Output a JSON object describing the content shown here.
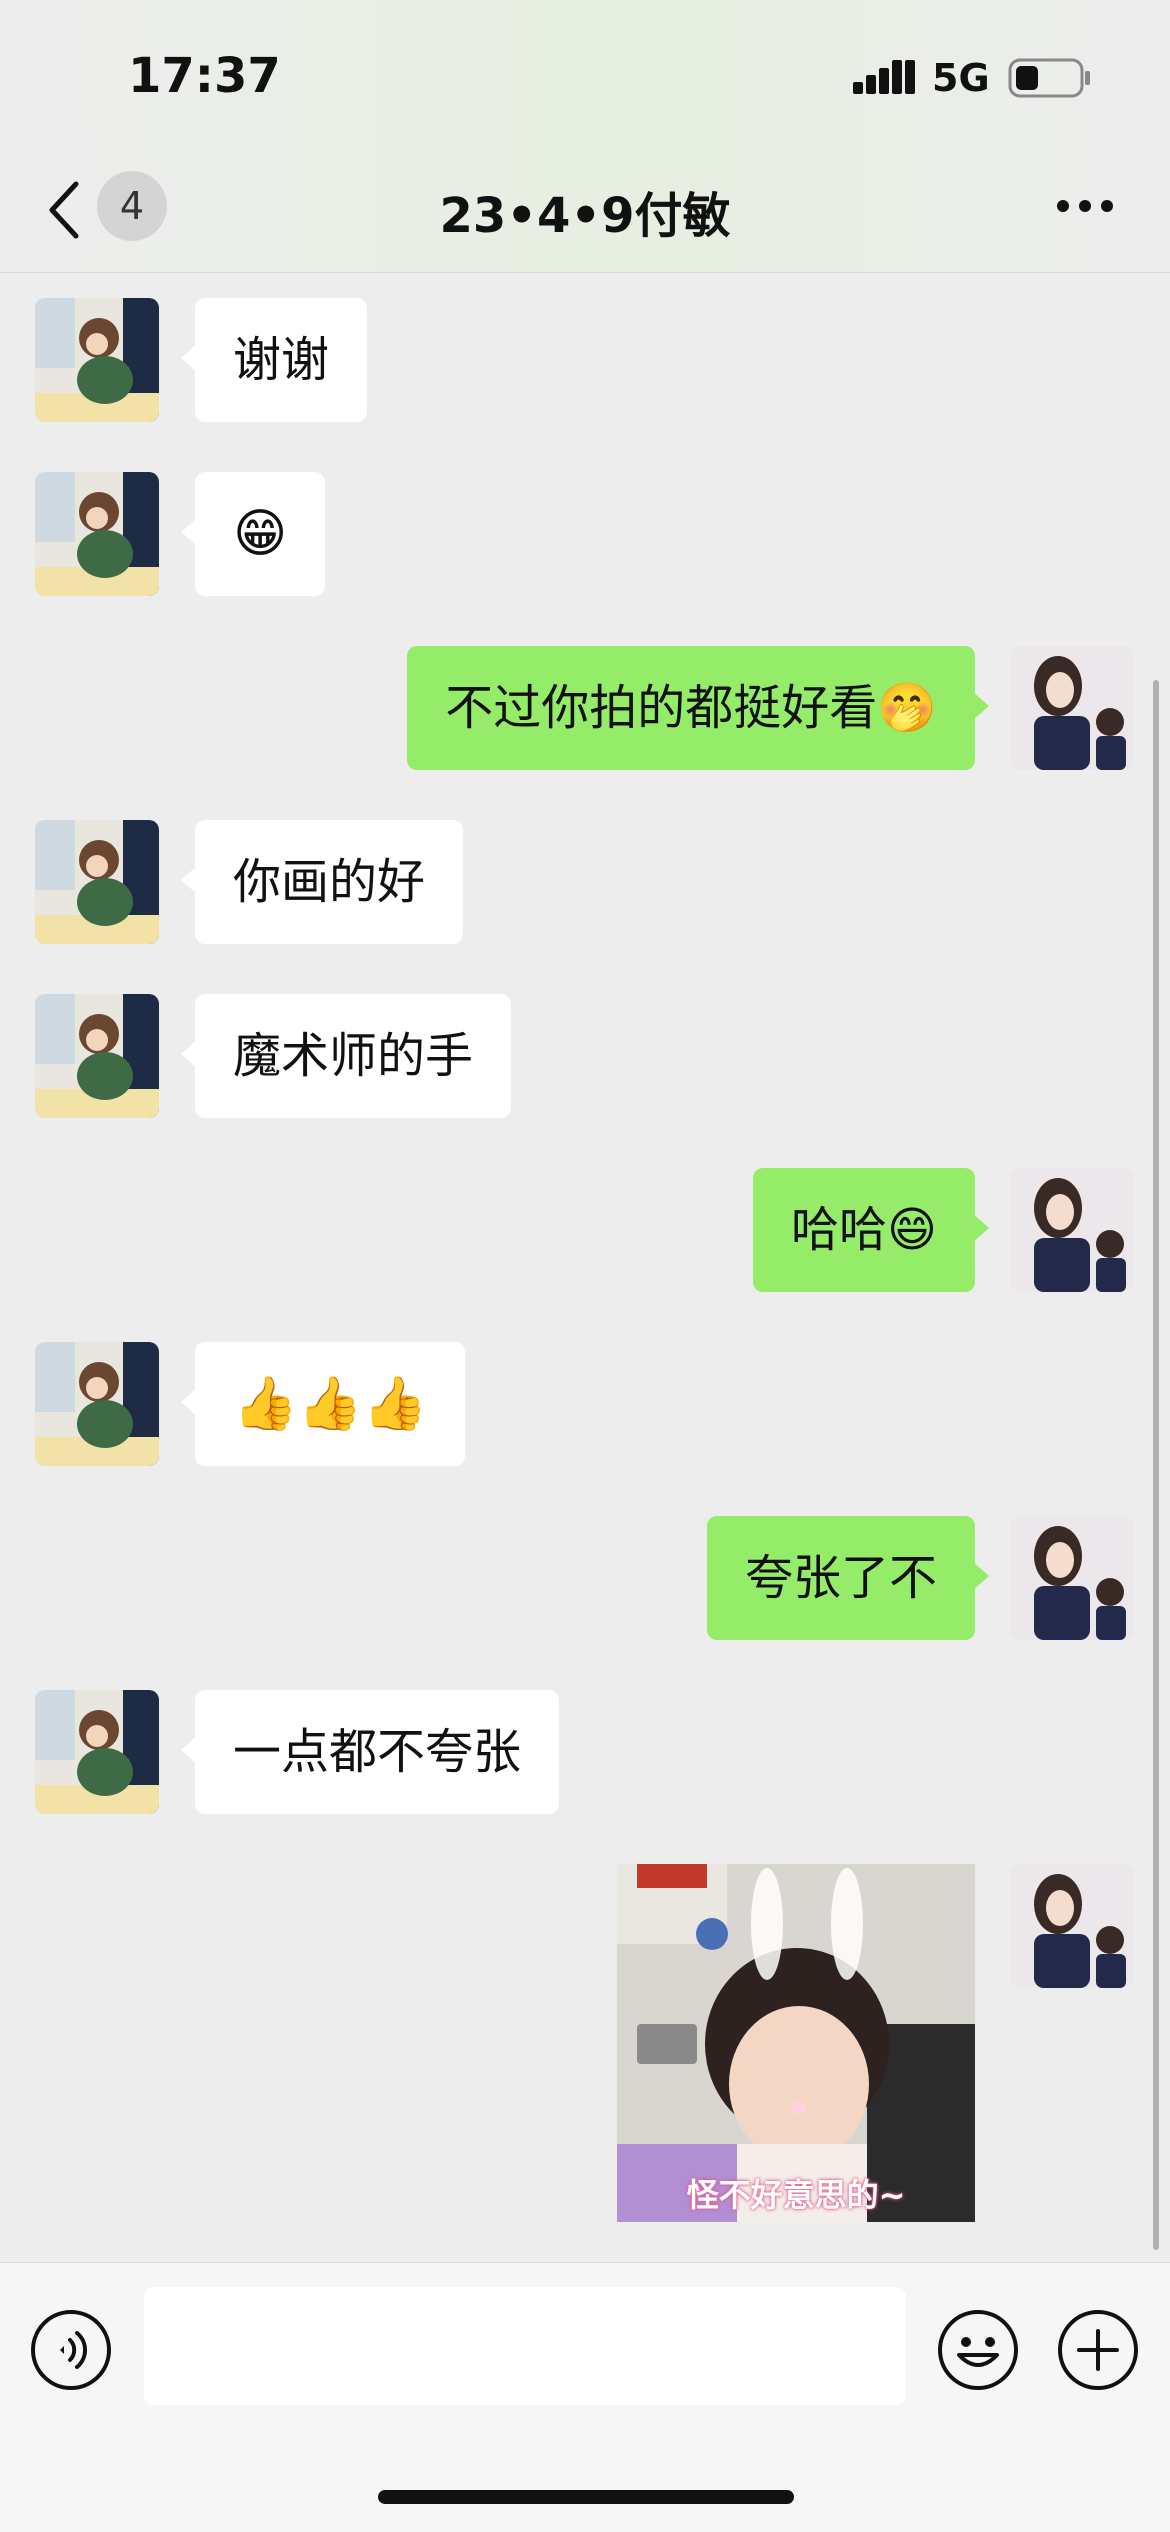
{
  "status_bar": {
    "time": "17:37",
    "network": "5G",
    "icons": [
      "signal-icon",
      "battery-icon"
    ]
  },
  "nav": {
    "back_icon": "chevron-left-icon",
    "unread_count": "4",
    "title": "23•4•9付敏",
    "more_icon": "more-dots-icon"
  },
  "messages": [
    {
      "side": "in",
      "text": "谢谢"
    },
    {
      "side": "in",
      "text": "😁"
    },
    {
      "side": "out",
      "text": "不过你拍的都挺好看🤭"
    },
    {
      "side": "in",
      "text": "你画的好"
    },
    {
      "side": "in",
      "text": "魔术师的手"
    },
    {
      "side": "out",
      "text": "哈哈😄"
    },
    {
      "side": "in",
      "text": "👍👍👍"
    },
    {
      "side": "out",
      "text": "夸张了不"
    },
    {
      "side": "in",
      "text": "一点都不夸张"
    },
    {
      "side": "out",
      "type": "sticker",
      "caption": "怪不好意思的~"
    }
  ],
  "input_bar": {
    "voice_icon": "voice-icon",
    "input_value": "",
    "emoji_icon": "emoji-icon",
    "plus_icon": "plus-icon"
  },
  "colors": {
    "background": "#ededed",
    "incoming_bubble": "#ffffff",
    "outgoing_bubble": "#95ec69"
  }
}
